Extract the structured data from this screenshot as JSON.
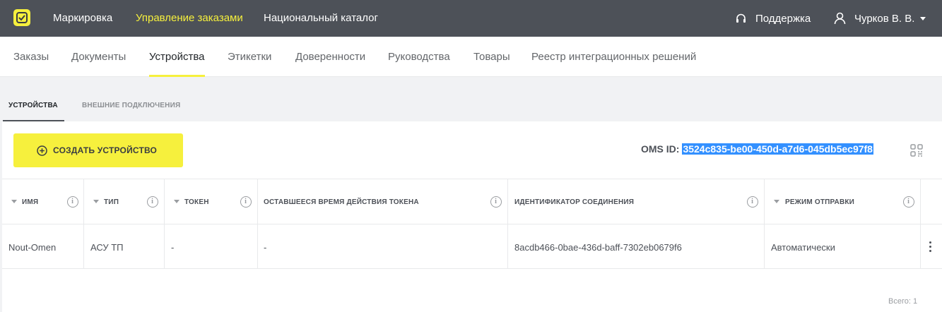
{
  "topbar": {
    "logo_icon": "marking-logo-icon",
    "nav": [
      "Маркировка",
      "Управление заказами",
      "Национальный каталог"
    ],
    "active_nav": "Управление заказами",
    "support_label": "Поддержка",
    "user_name": "Чурков В. В."
  },
  "subnav": {
    "items": [
      "Заказы",
      "Документы",
      "Устройства",
      "Этикетки",
      "Доверенности",
      "Руководства",
      "Товары",
      "Реестр интеграционных решений"
    ],
    "active": "Устройства"
  },
  "tabs": {
    "items": [
      "УСТРОЙСТВА",
      "ВНЕШНИЕ ПОДКЛЮЧЕНИЯ"
    ],
    "active": "УСТРОЙСТВА"
  },
  "toolbar": {
    "create_label": "СОЗДАТЬ УСТРОЙСТВО",
    "oms_label": "OMS ID:",
    "oms_value": "3524c835-be00-450d-a7d6-045db5ec97f8"
  },
  "table": {
    "columns": [
      "ИМЯ",
      "ТИП",
      "ТОКЕН",
      "ОСТАВШЕЕСЯ ВРЕМЯ ДЕЙСТВИЯ ТОКЕНА",
      "ИДЕНТИФИКАТОР СОЕДИНЕНИЯ",
      "РЕЖИМ ОТПРАВКИ"
    ],
    "rows": [
      [
        "Nout-Omen",
        "АСУ ТП",
        "-",
        "-",
        "8acdb466-0bae-436d-baff-7302eb0679f6",
        "Автоматически"
      ]
    ],
    "total_label": "Всего: 1"
  },
  "colors": {
    "accent": "#f6f03d",
    "topbar": "#4d5158",
    "selection": "#3390ff"
  }
}
